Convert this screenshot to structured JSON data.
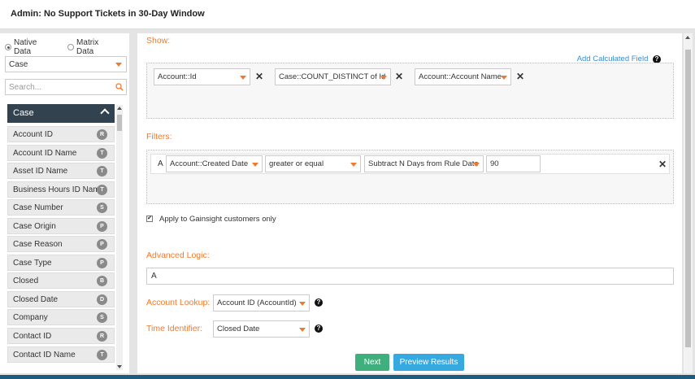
{
  "header": {
    "title": "Admin: No Support Tickets in 30-Day Window"
  },
  "left_panel": {
    "data_source": {
      "options": [
        "Native Data",
        "Matrix Data"
      ],
      "selected": "Native Data"
    },
    "object_select": "Case",
    "search_placeholder": "Search...",
    "list_title": "Case",
    "fields": [
      {
        "label": "Account ID",
        "type": "R"
      },
      {
        "label": "Account ID Name",
        "type": "T"
      },
      {
        "label": "Asset ID Name",
        "type": "T"
      },
      {
        "label": "Business Hours ID Name",
        "type": "T"
      },
      {
        "label": "Case Number",
        "type": "S"
      },
      {
        "label": "Case Origin",
        "type": "P"
      },
      {
        "label": "Case Reason",
        "type": "P"
      },
      {
        "label": "Case Type",
        "type": "P"
      },
      {
        "label": "Closed",
        "type": "B"
      },
      {
        "label": "Closed Date",
        "type": "D"
      },
      {
        "label": "Company",
        "type": "S"
      },
      {
        "label": "Contact ID",
        "type": "R"
      },
      {
        "label": "Contact ID Name",
        "type": "T"
      }
    ]
  },
  "show": {
    "label": "Show:",
    "add_calculated_field": "Add Calculated Field",
    "columns": [
      "Account::Id",
      "Case::COUNT_DISTINCT of Id",
      "Account::Account Name"
    ]
  },
  "filters": {
    "label": "Filters:",
    "rows": [
      {
        "id": "A",
        "field": "Account::Created Date",
        "operator": "greater or equal",
        "value_type": "Subtract N Days from Rule Date",
        "value": "90"
      }
    ],
    "apply_gainsight": {
      "label": "Apply to Gainsight customers only",
      "checked": true
    }
  },
  "advanced_logic": {
    "label": "Advanced Logic:",
    "value": "A"
  },
  "account_lookup": {
    "label": "Account Lookup:",
    "value": "Account ID (AccountId)"
  },
  "time_identifier": {
    "label": "Time Identifier:",
    "value": "Closed Date"
  },
  "buttons": {
    "next": "Next",
    "preview": "Preview Results"
  },
  "colors": {
    "accent": "#f07a2c",
    "link": "#3b8dd0",
    "next": "#3fb07d",
    "preview": "#36a9e1",
    "list_header": "#33424f"
  }
}
